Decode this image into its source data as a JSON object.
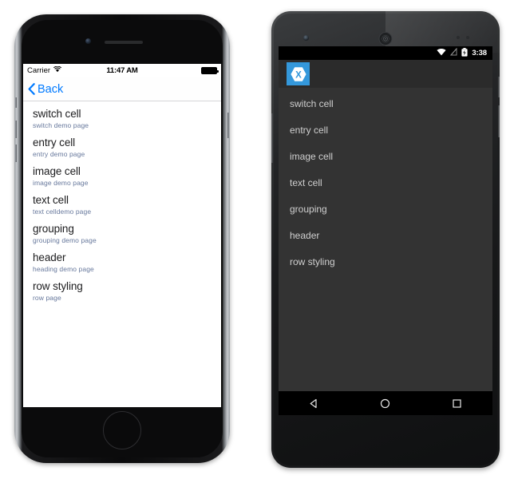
{
  "ios": {
    "status_bar": {
      "carrier": "Carrier",
      "wifi_icon": "wifi-icon",
      "time": "11:47 AM",
      "battery_icon": "battery-full-icon"
    },
    "nav_bar": {
      "back_label": "Back",
      "back_chevron_icon": "chevron-left-icon"
    },
    "list": [
      {
        "title": "switch cell",
        "subtitle": "switch demo page"
      },
      {
        "title": "entry cell",
        "subtitle": "entry demo page"
      },
      {
        "title": "image cell",
        "subtitle": "image demo page"
      },
      {
        "title": "text cell",
        "subtitle": "text celldemo page"
      },
      {
        "title": "grouping",
        "subtitle": "grouping demo page"
      },
      {
        "title": "header",
        "subtitle": "heading demo page"
      },
      {
        "title": "row styling",
        "subtitle": "row page"
      }
    ],
    "hardware": {
      "camera_icon": "front-camera-icon",
      "speaker_icon": "earpiece-speaker-icon",
      "home_button_icon": "home-button-icon"
    }
  },
  "android": {
    "status_bar": {
      "wifi_icon": "wifi-icon",
      "signal_icon": "cell-signal-off-icon",
      "battery_icon": "battery-charging-icon",
      "time": "3:38"
    },
    "action_bar": {
      "logo_icon": "xamarin-logo-icon",
      "logo_letter": "X",
      "logo_color": "#3498db"
    },
    "list": [
      {
        "title": "switch cell"
      },
      {
        "title": "entry cell"
      },
      {
        "title": "image cell"
      },
      {
        "title": "text cell"
      },
      {
        "title": "grouping"
      },
      {
        "title": "header"
      },
      {
        "title": "row styling"
      }
    ],
    "nav_bar": {
      "back_icon": "nav-back-triangle-icon",
      "home_icon": "nav-home-circle-icon",
      "recents_icon": "nav-recents-square-icon"
    },
    "hardware": {
      "camera_icon": "front-camera-icon",
      "speaker_icon": "earpiece-speaker-icon"
    }
  },
  "colors": {
    "ios_accent": "#007aff",
    "ios_subtitle": "#67789c",
    "android_bg": "#333333",
    "android_actionbar": "#2b2b2b",
    "android_text": "#cfcfcf",
    "xamarin_blue": "#3498db"
  }
}
